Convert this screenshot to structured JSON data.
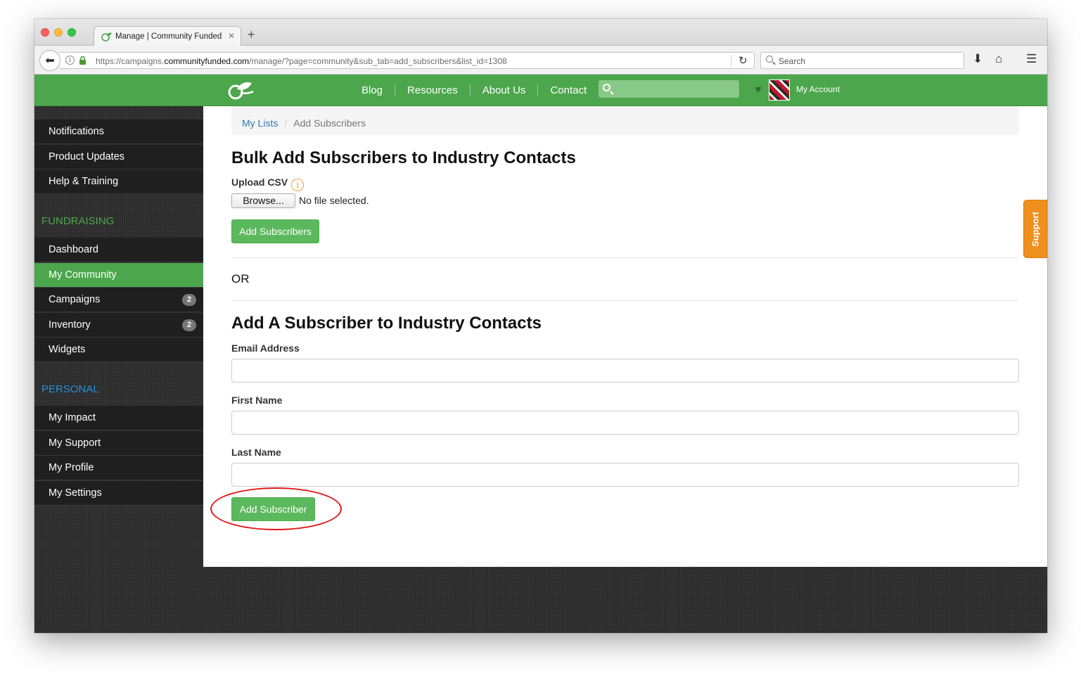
{
  "browser": {
    "tab_title": "Manage | Community Funded",
    "url_prefix": "https://campaigns.",
    "url_domain": "communityfunded.com",
    "url_path": "/manage/?page=community&sub_tab=add_subscribers&list_id=1308",
    "search_placeholder": "Search"
  },
  "header": {
    "nav": [
      "Blog",
      "Resources",
      "About Us",
      "Contact"
    ],
    "account_label": "My Account",
    "brand_color": "#4ca64c"
  },
  "sidebar": {
    "top_items": [
      {
        "label": "Notifications"
      },
      {
        "label": "Product Updates"
      },
      {
        "label": "Help & Training"
      }
    ],
    "fundraising_heading": "FUNDRAISING",
    "fundraising_items": [
      {
        "label": "Dashboard"
      },
      {
        "label": "My Community",
        "active": true
      },
      {
        "label": "Campaigns",
        "badge": "2"
      },
      {
        "label": "Inventory",
        "badge": "2"
      },
      {
        "label": "Widgets"
      }
    ],
    "personal_heading": "PERSONAL",
    "personal_items": [
      {
        "label": "My Impact"
      },
      {
        "label": "My Support"
      },
      {
        "label": "My Profile"
      },
      {
        "label": "My Settings"
      }
    ]
  },
  "breadcrumb": {
    "link": "My Lists",
    "current": "Add Subscribers"
  },
  "bulk": {
    "title": "Bulk Add Subscribers to Industry Contacts",
    "upload_label": "Upload CSV",
    "browse_label": "Browse...",
    "no_file": "No file selected.",
    "submit": "Add Subscribers"
  },
  "or_label": "OR",
  "single": {
    "title": "Add A Subscriber to Industry Contacts",
    "email_label": "Email Address",
    "email_value": "",
    "first_label": "First Name",
    "first_value": "",
    "last_label": "Last Name",
    "last_value": "",
    "submit": "Add Subscriber"
  },
  "support_tab": "Support",
  "colors": {
    "highlight_circle": "#e01818",
    "support": "#ef8f1c",
    "fundraising_heading": "#4ca64c",
    "personal_heading": "#2a8fd6"
  }
}
